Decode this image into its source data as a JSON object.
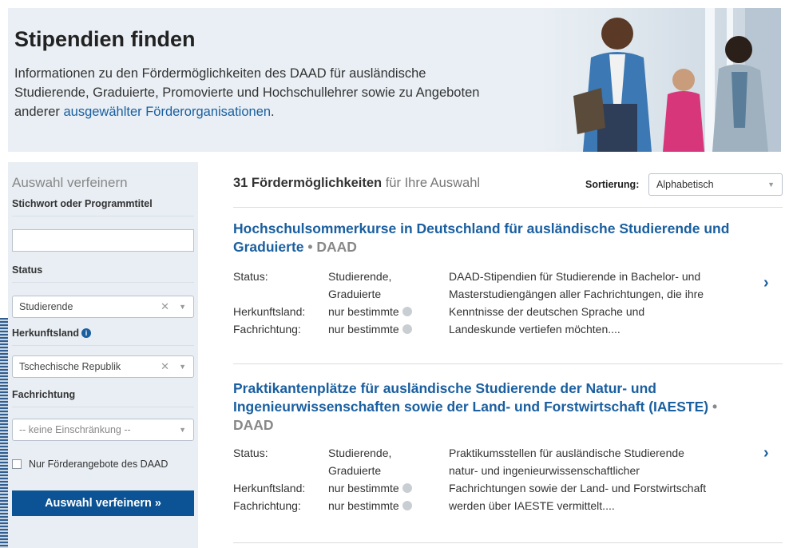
{
  "hero": {
    "title": "Stipendien finden",
    "text_before_link": "Informationen zu den Fördermöglichkeiten des DAAD für ausländische Studierende, Graduierte, Promovierte und Hochschullehrer sowie zu Angeboten anderer ",
    "link": "ausgewählter Förderorganisationen",
    "text_after_link": ".",
    "link_color": "#1a5fa0"
  },
  "sidebar": {
    "heading": "Auswahl verfeinern",
    "keyword_label": "Stichwort oder Programmtitel",
    "keyword_value": "",
    "status_label": "Status",
    "status_value": "Studierende",
    "country_label": "Herkunftsland",
    "country_value": "Tschechische Republik",
    "subject_label": "Fachrichtung",
    "subject_value": "-- keine Einschränkung --",
    "daad_only_label": "Nur Förderangebote des DAAD",
    "daad_only_checked": false,
    "submit_label": "Auswahl verfeinern »",
    "submit_color": "#0b5394"
  },
  "results": {
    "count_bold": "31 Fördermöglichkeiten",
    "count_rest": " für Ihre Auswahl",
    "sort_label": "Sortierung:",
    "sort_value": "Alphabetisch",
    "items": [
      {
        "title": "Hochschulsommerkurse in Deutschland für ausländische Studierende und Graduierte",
        "org": "DAAD",
        "status_key": "Status:",
        "status_line1": "Studierende,",
        "status_line2": "Graduierte",
        "country_key": "Herkunftsland:",
        "country_val": "nur bestimmte",
        "subject_key": "Fachrichtung:",
        "subject_val": "nur bestimmte",
        "desc": [
          "DAAD-Stipendien für Studierende in Bachelor- und",
          "Masterstudiengängen aller Fachrichtungen, die ihre",
          "Kenntnisse der deutschen Sprache und",
          "Landeskunde vertiefen möchten...."
        ]
      },
      {
        "title_line1": "Praktikantenplätze für ausländische Studierende der Natur- und",
        "title_line2": "Ingenieurwissenschaften sowie der Land- und Forstwirtschaft (IAESTE)",
        "org": "DAAD",
        "status_key": "Status:",
        "status_line1": "Studierende,",
        "status_line2": "Graduierte",
        "country_key": "Herkunftsland:",
        "country_val": "nur bestimmte",
        "subject_key": "Fachrichtung:",
        "subject_val": "nur bestimmte",
        "desc": [
          "Praktikumsstellen für ausländische Studierende",
          "natur- und ingenieurwissenschaftlicher",
          "Fachrichtungen sowie der Land- und Forstwirtschaft",
          "werden über IAESTE vermittelt...."
        ]
      }
    ]
  },
  "icons": {
    "info": "info-icon",
    "clear": "clear-icon",
    "dropdown": "chevron-down-icon",
    "next": "chevron-right-icon"
  }
}
